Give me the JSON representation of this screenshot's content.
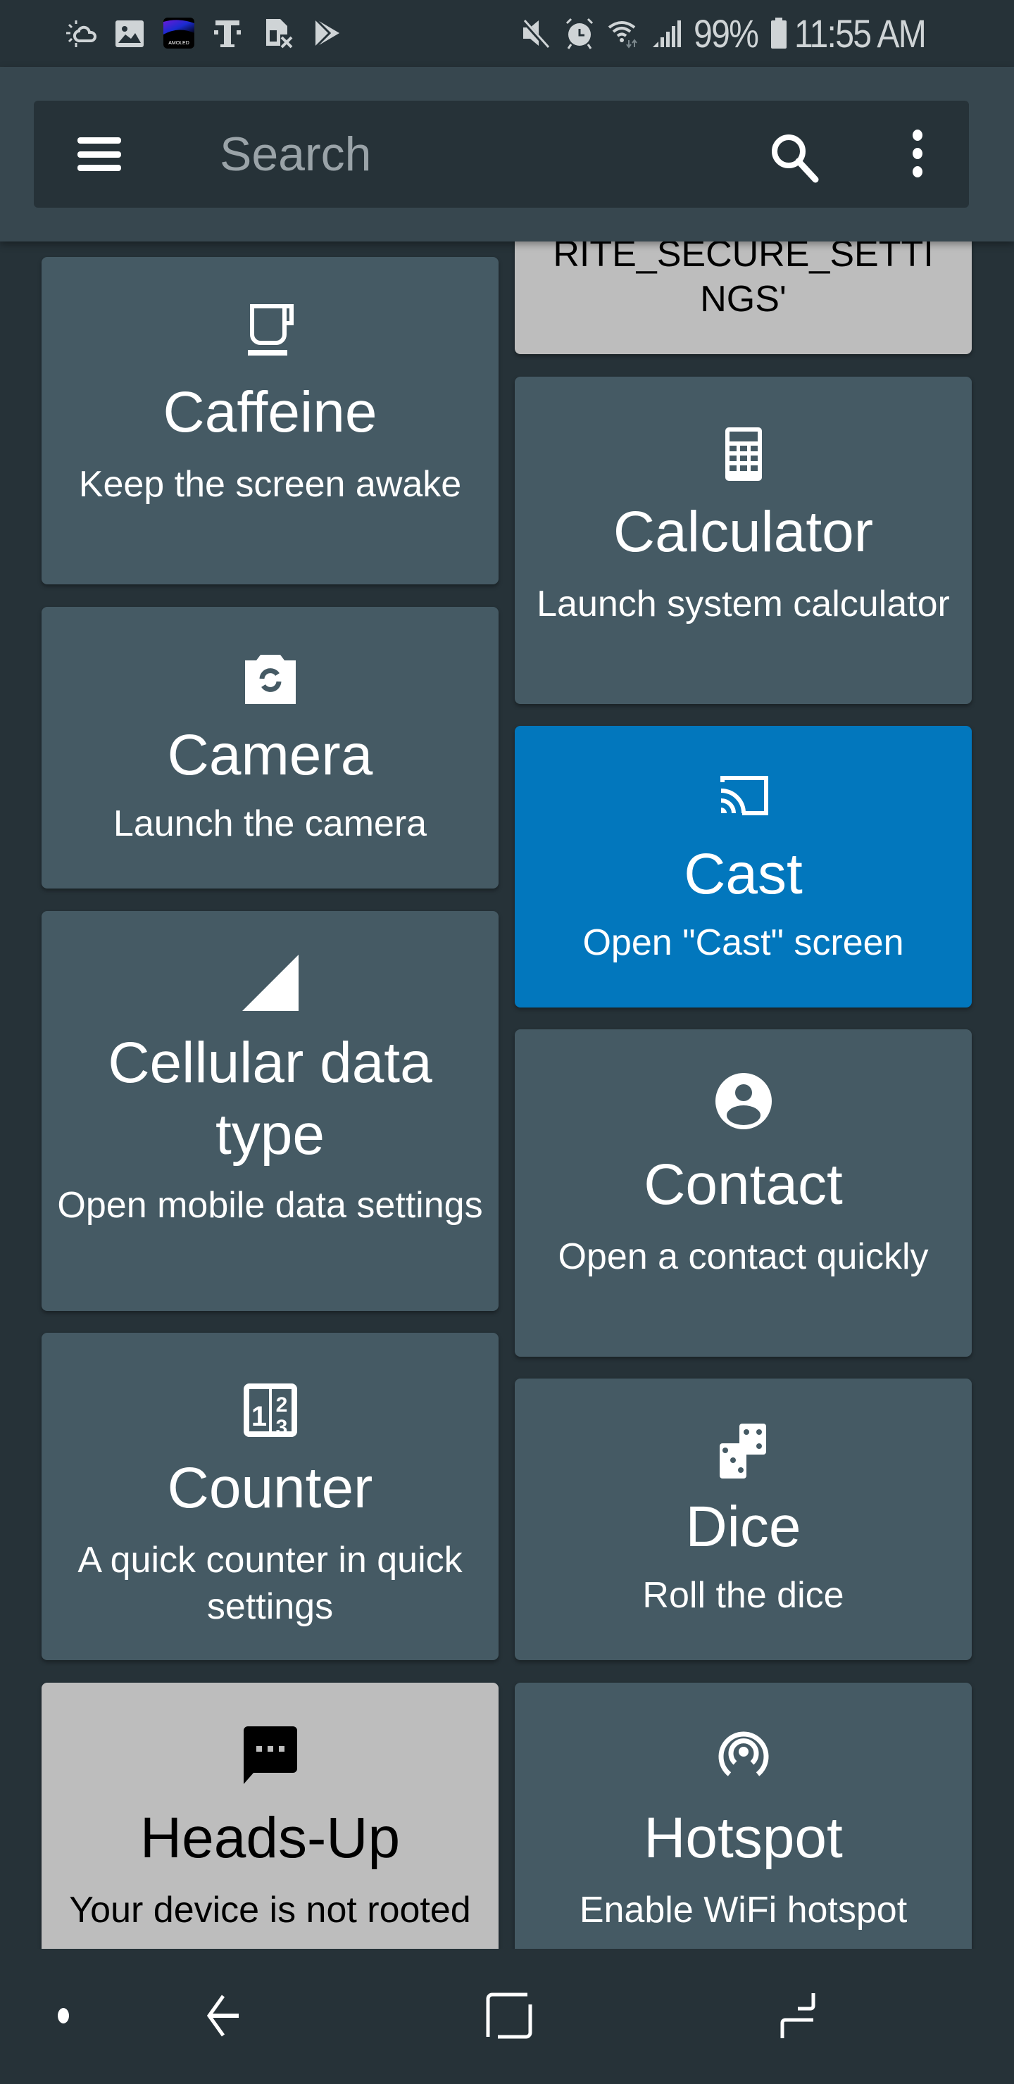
{
  "status_bar": {
    "left_icons": [
      "weather-icon",
      "gallery-icon",
      "amoled-app-icon",
      "tmobile-icon",
      "no-sim-icon",
      "play-store-icon"
    ],
    "amoled_label": "AMOLED",
    "right_icons": [
      "mute-icon",
      "alarm-icon",
      "wifi-data-icon",
      "cellular-signal-icon"
    ],
    "battery_percent": "99%",
    "time": "11:55 AM"
  },
  "app_bar": {
    "search_placeholder": "Search",
    "search_value": ""
  },
  "tiles": [
    {
      "id": "write-secure-settings",
      "title": "",
      "subtitle_partial": "RITE_SECURE_SETTI",
      "subtitle_line2": "NGS'",
      "state": "disabled",
      "icon": "none"
    },
    {
      "id": "caffeine",
      "title": "Caffeine",
      "subtitle": "Keep the screen awake",
      "state": "normal",
      "icon": "coffee-cup-icon"
    },
    {
      "id": "calculator",
      "title": "Calculator",
      "subtitle": "Launch system calculator",
      "state": "normal",
      "icon": "calculator-icon"
    },
    {
      "id": "camera",
      "title": "Camera",
      "subtitle": "Launch the camera",
      "state": "normal",
      "icon": "camera-switch-icon"
    },
    {
      "id": "cast",
      "title": "Cast",
      "subtitle": "Open \"Cast\" screen",
      "state": "active",
      "icon": "cast-icon"
    },
    {
      "id": "cellular-data-type",
      "title": "Cellular data type",
      "subtitle": "Open mobile data settings",
      "state": "normal",
      "icon": "signal-triangle-icon"
    },
    {
      "id": "contact",
      "title": "Contact",
      "subtitle": "Open a contact quickly",
      "state": "normal",
      "icon": "account-circle-icon"
    },
    {
      "id": "counter",
      "title": "Counter",
      "subtitle": "A quick counter in quick settings",
      "state": "normal",
      "icon": "counter-icon"
    },
    {
      "id": "dice",
      "title": "Dice",
      "subtitle": "Roll the dice",
      "state": "normal",
      "icon": "dice-icon"
    },
    {
      "id": "heads-up",
      "title": "Heads-Up",
      "subtitle": "Your device is not rooted",
      "state": "disabled",
      "icon": "chat-bubble-icon"
    },
    {
      "id": "hotspot",
      "title": "Hotspot",
      "subtitle": "Enable WiFi hotspot",
      "state": "normal",
      "icon": "hotspot-icon"
    }
  ],
  "colors": {
    "background": "#263238",
    "app_bar": "#37474f",
    "tile": "#455a64",
    "tile_active": "#0277bd",
    "tile_disabled": "#bdbdbd"
  },
  "nav_bar": {
    "buttons": [
      "dot-indicator",
      "back",
      "home",
      "recents"
    ]
  }
}
